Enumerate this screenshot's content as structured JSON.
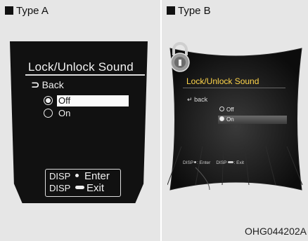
{
  "type_a": {
    "label": "Type A",
    "title": "Lock/Unlock Sound",
    "back_label": "Back",
    "options": [
      {
        "label": "Off",
        "selected": true
      },
      {
        "label": "On",
        "selected": false
      }
    ],
    "keys": {
      "enter_key": "DISP",
      "enter_label": "Enter",
      "exit_key": "DISP",
      "exit_label": "Exit"
    }
  },
  "type_b": {
    "label": "Type B",
    "title": "Lock/Unlock Sound",
    "back_label": "back",
    "options": [
      {
        "label": "Off",
        "selected": false
      },
      {
        "label": "On",
        "selected": true
      }
    ],
    "keys": {
      "enter_key": "DISP",
      "enter_label": ": Enter",
      "exit_key": "DISP",
      "exit_label": ": Exit"
    }
  },
  "figure_code": "OHG044202A",
  "colors": {
    "panel_bg": "#e6e6e6",
    "screen_a_bg": "#111111",
    "screen_b_title": "#ffd54a"
  }
}
